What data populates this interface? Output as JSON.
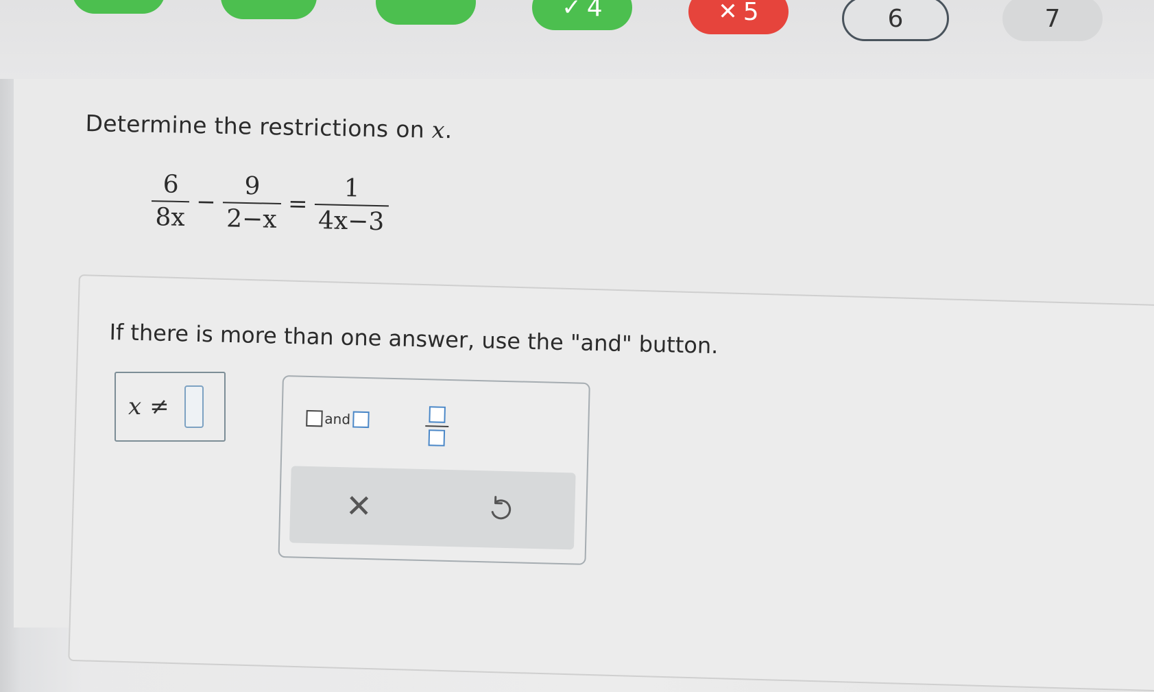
{
  "question_nav": [
    {
      "number": "",
      "status": "correct",
      "mark": ""
    },
    {
      "number": "",
      "status": "correct",
      "mark": ""
    },
    {
      "number": "",
      "status": "correct",
      "mark": ""
    },
    {
      "number": "4",
      "status": "correct",
      "mark": "✓"
    },
    {
      "number": "5",
      "status": "wrong",
      "mark": "✕"
    },
    {
      "number": "6",
      "status": "current",
      "mark": ""
    },
    {
      "number": "7",
      "status": "upcoming",
      "mark": ""
    }
  ],
  "question": {
    "prompt_prefix": "Determine the restrictions on ",
    "prompt_var": "x",
    "prompt_suffix": ".",
    "equation": {
      "term1": {
        "num": "6",
        "den": "8x"
      },
      "op1": "−",
      "term2": {
        "num": "9",
        "den": "2−x"
      },
      "op2": "=",
      "term3": {
        "num": "1",
        "den": "4x−3"
      }
    }
  },
  "instruction": "If there is more than one answer, use the \"and\" button.",
  "answer": {
    "variable": "x",
    "relation": "≠",
    "value": ""
  },
  "keypad": {
    "and_label": "and",
    "clear_icon": "✕",
    "undo_icon": "undo-icon"
  },
  "colors": {
    "correct": "#4cbf4f",
    "wrong": "#e6443c",
    "current_border": "#49535c",
    "input_border": "#7da2c2"
  }
}
